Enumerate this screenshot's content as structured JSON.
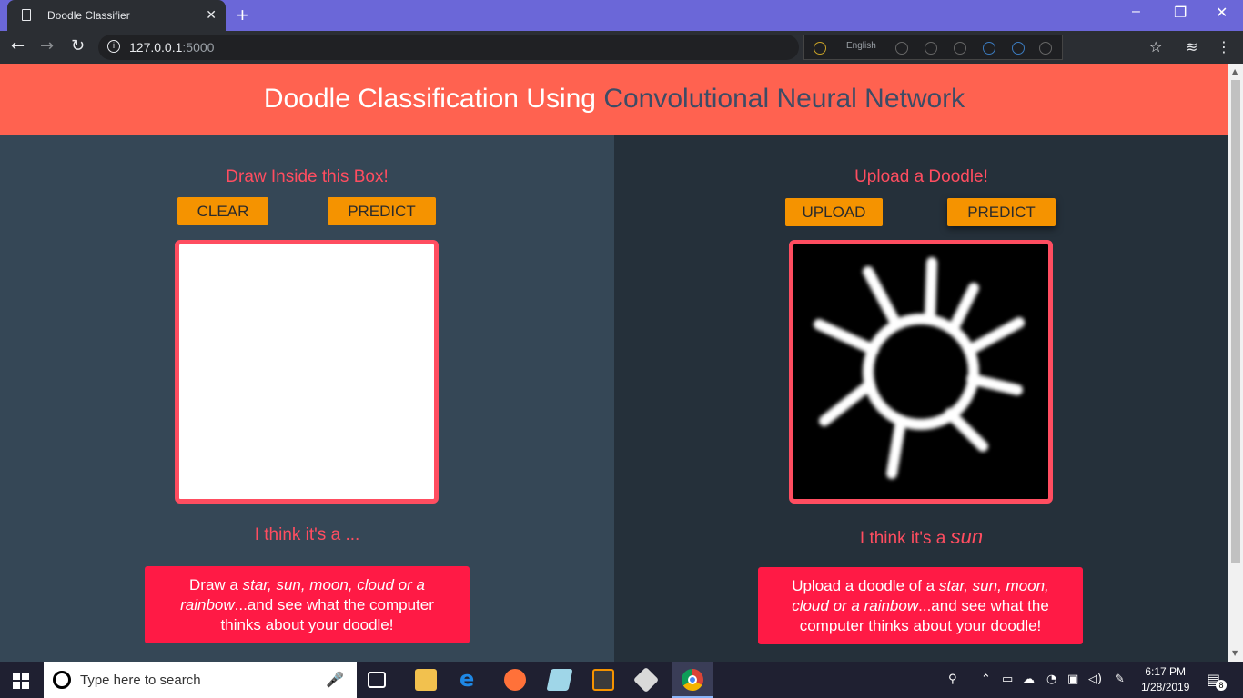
{
  "browser": {
    "tab_title": "Doodle Classifier",
    "url_host": "127.0.0.1",
    "url_port": ":5000",
    "extension_language": "English"
  },
  "header": {
    "title_main": "Doodle Classification Using ",
    "title_accent": "Convolutional Neural Network"
  },
  "left_panel": {
    "title": "Draw Inside this Box!",
    "clear_label": "CLEAR",
    "predict_label": "PREDICT",
    "guess_prefix": "I think it's a ",
    "guess_value": "...",
    "card_text_1": "Draw a ",
    "card_italic": "star, sun, moon, cloud or a rainbow",
    "card_text_2": "...and see what the computer thinks about your doodle!"
  },
  "right_panel": {
    "title": "Upload a Doodle!",
    "upload_label": "UPLOAD",
    "predict_label": "PREDICT",
    "guess_prefix": "I think it's a ",
    "guess_value": "sun",
    "card_text_1": "Upload a doodle of a ",
    "card_italic": "star, sun, moon, cloud or a rainbow",
    "card_text_2": "...and see what the computer thinks about your doodle!"
  },
  "taskbar": {
    "search_placeholder": "Type here to search",
    "time": "6:17 PM",
    "date": "1/28/2019",
    "notification_count": "8"
  },
  "colors": {
    "header_bg": "#ff6250",
    "accent_red": "#ff4d60",
    "button_orange": "#f59300",
    "card_red": "#ff1a45"
  }
}
